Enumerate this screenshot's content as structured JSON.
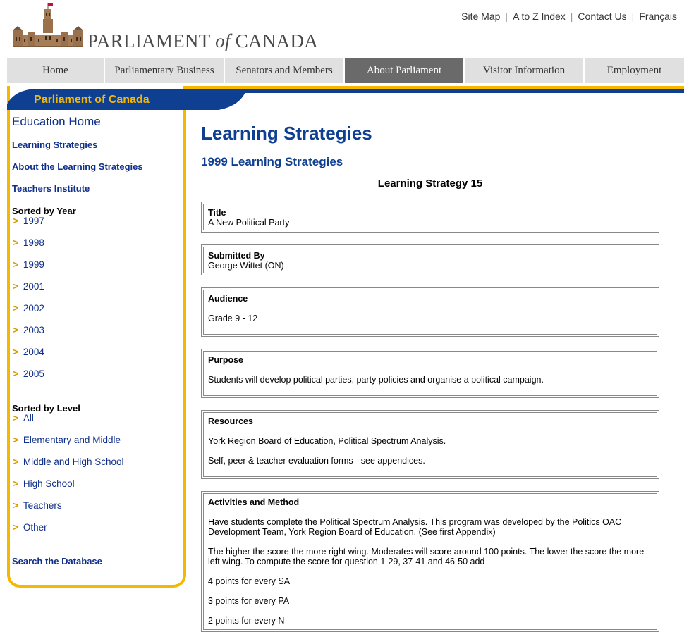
{
  "header": {
    "logo_name": "PARLIAMENT of CANADA",
    "logo_left": "PARLIAMENT",
    "logo_of": "of",
    "logo_right": "CANADA",
    "util_links": [
      "Site Map",
      "A to Z Index",
      "Contact Us",
      "Français"
    ]
  },
  "nav": {
    "tabs": [
      {
        "label": "Home"
      },
      {
        "label": "Parliamentary Business"
      },
      {
        "label": "Senators and Members"
      },
      {
        "label": "About Parliament",
        "active": true
      },
      {
        "label": "Visitor Information"
      },
      {
        "label": "Employment"
      }
    ]
  },
  "sidebar": {
    "header": "Parliament of Canada",
    "education_home": "Education Home",
    "links": [
      "Learning Strategies",
      "About the Learning Strategies",
      "Teachers Institute"
    ],
    "year_heading": "Sorted by Year",
    "years": [
      "1997",
      "1998",
      "1999",
      "2001",
      "2002",
      "2003",
      "2004",
      "2005"
    ],
    "level_heading": "Sorted by Level",
    "levels": [
      "All",
      "Elementary and Middle",
      "Middle and High School",
      "High School",
      "Teachers",
      "Other"
    ],
    "search": "Search the Database",
    "bullet": ">"
  },
  "main": {
    "title": "Learning Strategies",
    "subtitle": "1999 Learning Strategies",
    "strategy_heading": "Learning Strategy 15",
    "title_box": {
      "label": "Title",
      "value": "A New Political Party"
    },
    "submitted_box": {
      "label": "Submitted By",
      "value": "George Wittet (ON)"
    },
    "audience_box": {
      "label": "Audience",
      "value": "Grade 9 - 12"
    },
    "purpose_box": {
      "label": "Purpose",
      "value": "Students will develop political parties, party policies and organise a political campaign."
    },
    "resources_box": {
      "label": "Resources",
      "p1": "York Region Board of Education, Political Spectrum Analysis.",
      "p2": "Self, peer & teacher evaluation forms - see appendices."
    },
    "activities_box": {
      "label": "Activities and Method",
      "p1": "Have students complete the Political Spectrum Analysis. This program was developed by the Politics OAC Development Team, York Region Board of Education. (See first Appendix)",
      "p2": "The higher the score the more right wing. Moderates will score around 100 points. The lower the score the more left wing. To compute the score for question 1-29, 37-41 and 46-50 add",
      "p3": "4 points for every SA",
      "p4": "3 points for every PA",
      "p5": "2 points for every N"
    }
  },
  "colors": {
    "accent_blue": "#0f3f91",
    "accent_yellow": "#f5b800",
    "nav_active": "#6a6a6a"
  }
}
